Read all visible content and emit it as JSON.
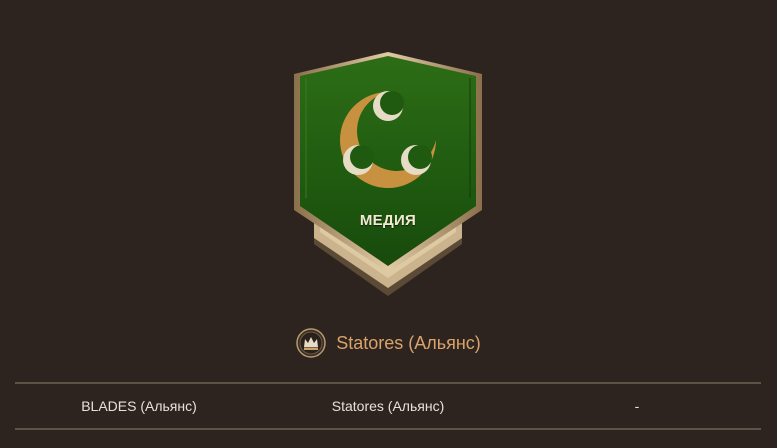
{
  "emblem": {
    "name": "МЕДИЯ",
    "banner_color": "#1f5a10",
    "frame_color": "#cdb48f",
    "crescent_color": "#c8913f",
    "moon_color": "#e6dcc5",
    "icon": "crescent-three-moons-icon"
  },
  "owner": {
    "icon": "alliance-crown-icon",
    "label": "Statores (Альянс)"
  },
  "table": {
    "rows": [
      {
        "col1": "BLADES (Альянс)",
        "col2": "Statores (Альянс)",
        "col3": "-"
      }
    ]
  },
  "colors": {
    "background": "#2d2420",
    "owner_text": "#d9a36b",
    "divider": "#5f5247"
  }
}
